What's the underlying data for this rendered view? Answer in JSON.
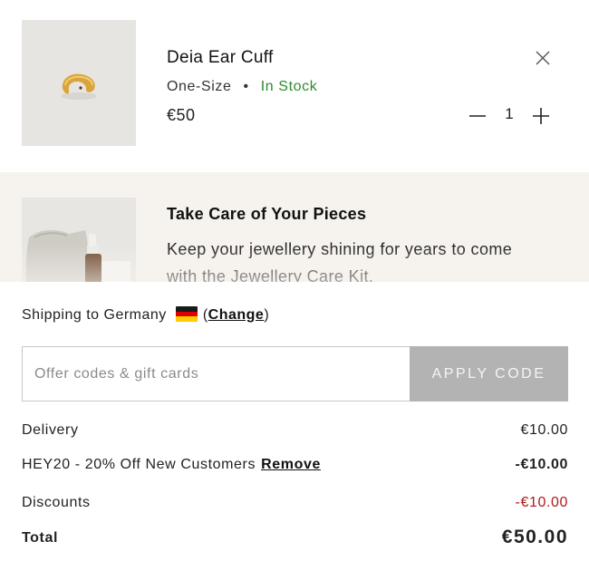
{
  "cart_item": {
    "image_name": "gold-ear-cuff-image",
    "title": "Deia Ear Cuff",
    "size": "One-Size",
    "separator": "•",
    "stock": "In Stock",
    "stock_color": "#2e8b2e",
    "price": "€50",
    "quantity": "1",
    "remove_icon": "close-icon",
    "decrease_icon": "minus-icon",
    "increase_icon": "plus-icon"
  },
  "upsell": {
    "image_name": "jewellery-care-kit-image",
    "title": "Take Care of Your Pieces",
    "text": "Keep your jewellery shining for years to come with the Jewellery Care Kit.",
    "background": "#f6f3ee"
  },
  "shipping": {
    "text": "Shipping to Germany",
    "flag": "germany-flag-icon",
    "open_paren": "(",
    "change_label": "Change",
    "close_paren": ")"
  },
  "offer": {
    "placeholder": "Offer codes & gift cards",
    "value": "",
    "apply_label": "APPLY CODE",
    "apply_bg": "#b3b3b3"
  },
  "totals": {
    "delivery_label": "Delivery",
    "delivery_value": "€10.00",
    "code_label": "HEY20 - 20% Off New Customers",
    "code_remove": "Remove",
    "code_value": "-€10.00",
    "discounts_label": "Discounts",
    "discounts_value": "-€10.00",
    "discount_color": "#b01a1a",
    "total_label": "Total",
    "total_value": "€50.00"
  }
}
